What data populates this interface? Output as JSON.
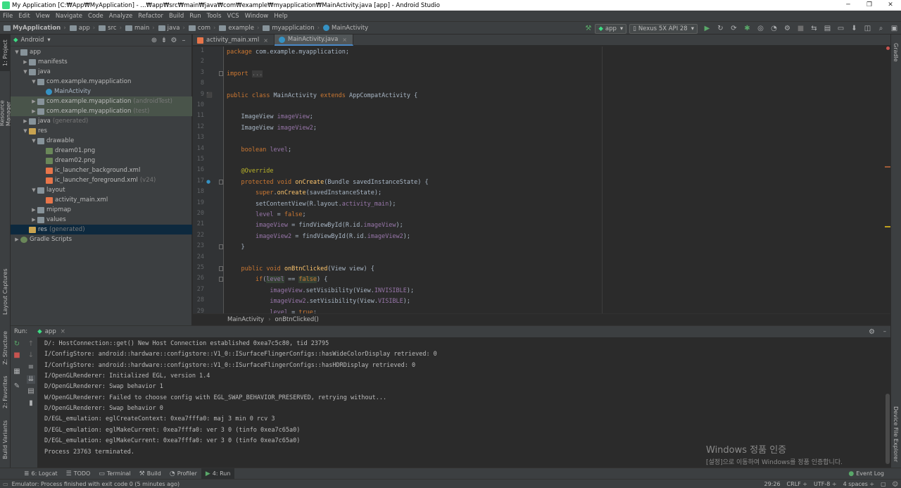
{
  "window": {
    "title": "My Application [C:₩App₩MyApplication] - ...₩app₩src₩main₩java₩com₩example₩myapplication₩MainActivity.java [app] - Android Studio",
    "controls": [
      "─",
      "❐",
      "✕"
    ]
  },
  "menu": [
    "File",
    "Edit",
    "View",
    "Navigate",
    "Code",
    "Analyze",
    "Refactor",
    "Build",
    "Run",
    "Tools",
    "VCS",
    "Window",
    "Help"
  ],
  "breadcrumbs": [
    "MyApplication",
    "app",
    "src",
    "main",
    "java",
    "com",
    "example",
    "myapplication",
    "MainActivity"
  ],
  "toolbar": {
    "run_config": "app",
    "device": "Nexus 5X API 28"
  },
  "left_stripe": {
    "project": "1: Project",
    "resource_manager": "Resource Manager",
    "layout_captures": "Layout Captures",
    "structure": "Z: Structure",
    "favorites": "2: Favorites",
    "build_variants": "Build Variants"
  },
  "right_stripe": {
    "gradle": "Gradle",
    "device_file_explorer": "Device File Explorer"
  },
  "project_panel": {
    "view_mode": "Android",
    "tree": [
      {
        "label": "app",
        "extra": "",
        "depth": 0,
        "arrow": "▼",
        "icon": "folder"
      },
      {
        "label": "manifests",
        "extra": "",
        "depth": 1,
        "arrow": "▶",
        "icon": "folder"
      },
      {
        "label": "java",
        "extra": "",
        "depth": 1,
        "arrow": "▼",
        "icon": "folder"
      },
      {
        "label": "com.example.myapplication",
        "extra": "",
        "depth": 2,
        "arrow": "▼",
        "icon": "pkg"
      },
      {
        "label": "MainActivity",
        "extra": "",
        "depth": 3,
        "arrow": "",
        "icon": "class"
      },
      {
        "label": "com.example.myapplication",
        "extra": "(androidTest)",
        "depth": 2,
        "arrow": "▶",
        "icon": "pkg"
      },
      {
        "label": "com.example.myapplication",
        "extra": "(test)",
        "depth": 2,
        "arrow": "▶",
        "icon": "pkg"
      },
      {
        "label": "java",
        "extra": "(generated)",
        "depth": 1,
        "arrow": "▶",
        "icon": "folder"
      },
      {
        "label": "res",
        "extra": "",
        "depth": 1,
        "arrow": "▼",
        "icon": "res"
      },
      {
        "label": "drawable",
        "extra": "",
        "depth": 2,
        "arrow": "▼",
        "icon": "folder"
      },
      {
        "label": "dream01.png",
        "extra": "",
        "depth": 3,
        "arrow": "",
        "icon": "png"
      },
      {
        "label": "dream02.png",
        "extra": "",
        "depth": 3,
        "arrow": "",
        "icon": "png"
      },
      {
        "label": "ic_launcher_background.xml",
        "extra": "",
        "depth": 3,
        "arrow": "",
        "icon": "xml"
      },
      {
        "label": "ic_launcher_foreground.xml",
        "extra": "(v24)",
        "depth": 3,
        "arrow": "",
        "icon": "xml"
      },
      {
        "label": "layout",
        "extra": "",
        "depth": 2,
        "arrow": "▼",
        "icon": "folder"
      },
      {
        "label": "activity_main.xml",
        "extra": "",
        "depth": 3,
        "arrow": "",
        "icon": "xml"
      },
      {
        "label": "mipmap",
        "extra": "",
        "depth": 2,
        "arrow": "▶",
        "icon": "folder"
      },
      {
        "label": "values",
        "extra": "",
        "depth": 2,
        "arrow": "▶",
        "icon": "folder"
      },
      {
        "label": "res",
        "extra": "(generated)",
        "depth": 1,
        "arrow": "",
        "icon": "res"
      },
      {
        "label": "Gradle Scripts",
        "extra": "",
        "depth": 0,
        "arrow": "▶",
        "icon": "gradle"
      }
    ]
  },
  "editor": {
    "tabs": [
      {
        "label": "activity_main.xml",
        "active": false
      },
      {
        "label": "MainActivity.java",
        "active": true
      }
    ],
    "line_numbers": [
      "1",
      "2",
      "3",
      "8",
      "9",
      "10",
      "11",
      "12",
      "13",
      "14",
      "15",
      "16",
      "17",
      "18",
      "19",
      "20",
      "21",
      "22",
      "23",
      "24",
      "25",
      "26",
      "27",
      "28",
      "29"
    ],
    "lines": [
      "package com.example.myapplication;",
      "",
      "import ...",
      "",
      "public class MainActivity extends AppCompatActivity {",
      "",
      "    ImageView imageView;",
      "    ImageView imageView2;",
      "",
      "    boolean level;",
      "",
      "    @Override",
      "    protected void onCreate(Bundle savedInstanceState) {",
      "        super.onCreate(savedInstanceState);",
      "        setContentView(R.layout.activity_main);",
      "        level = false;",
      "        imageView = findViewById(R.id.imageView);",
      "        imageView2 = findViewById(R.id.imageView2);",
      "    }",
      "",
      "    public void onBtnClicked(View view) {",
      "        if(level == false) {",
      "            imageView.setVisibility(View.INVISIBLE);",
      "            imageView2.setVisibility(View.VISIBLE);",
      "            level = true;"
    ],
    "breadcrumb": [
      "MainActivity",
      "onBtnClicked()"
    ]
  },
  "run_panel": {
    "label": "Run:",
    "tab": "app",
    "console": [
      "D/: HostConnection::get() New Host Connection established 0xea7c5c80, tid 23795",
      "I/ConfigStore: android::hardware::configstore::V1_0::ISurfaceFlingerConfigs::hasWideColorDisplay retrieved: 0",
      "I/ConfigStore: android::hardware::configstore::V1_0::ISurfaceFlingerConfigs::hasHDRDisplay retrieved: 0",
      "I/OpenGLRenderer: Initialized EGL, version 1.4",
      "D/OpenGLRenderer: Swap behavior 1",
      "W/OpenGLRenderer: Failed to choose config with EGL_SWAP_BEHAVIOR_PRESERVED, retrying without...",
      "D/OpenGLRenderer: Swap behavior 0",
      "D/EGL_emulation: eglCreateContext: 0xea7fffa0: maj 3 min 0 rcv 3",
      "D/EGL_emulation: eglMakeCurrent: 0xea7fffa0: ver 3 0 (tinfo 0xea7c65a0)",
      "D/EGL_emulation: eglMakeCurrent: 0xea7fffa0: ver 3 0 (tinfo 0xea7c65a0)",
      "Process 23763 terminated."
    ]
  },
  "watermark": {
    "line1": "Windows 정품 인증",
    "line2": "[설정]으로 이동하여 Windows를 정품 인증합니다."
  },
  "bottom_tabs": [
    "6: Logcat",
    "TODO",
    "Terminal",
    "Build",
    "Profiler",
    "4: Run"
  ],
  "event_log": "Event Log",
  "status": {
    "message": "Emulator: Process finished with exit code 0 (5 minutes ago)",
    "position": "29:26",
    "line_sep": "CRLF ÷",
    "encoding": "UTF-8 ÷",
    "indent": "4 spaces ÷"
  },
  "colors": {
    "background": "#2b2b2b",
    "panel": "#3c3f41",
    "keyword": "#cc7832",
    "method": "#ffc66d",
    "field": "#9876aa",
    "annotation": "#bbb529",
    "selection": "#0d293e"
  }
}
